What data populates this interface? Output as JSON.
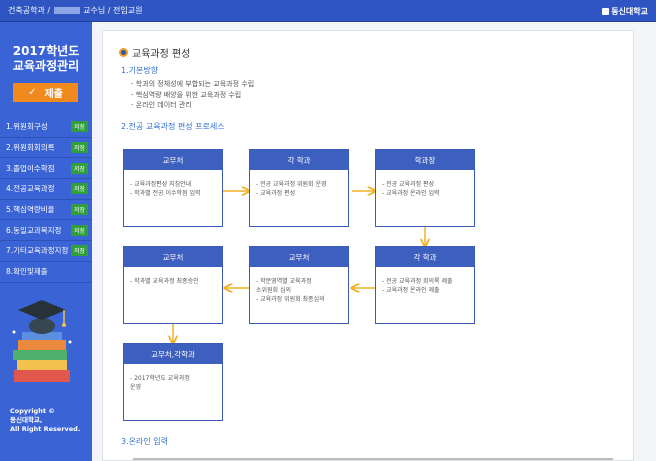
{
  "topbar": {
    "crumb_prefix": "건축공학과 /",
    "crumb_suffix": "교수님 / 전임교원",
    "logo": "동신대학교"
  },
  "sidebar": {
    "title_line1": "2017학년도",
    "title_line2": "교육과정관리",
    "submit_label": "제출",
    "items": [
      {
        "label": "1.위원회구성",
        "badge": "저장"
      },
      {
        "label": "2.위원회회의록",
        "badge": "저장"
      },
      {
        "label": "3.졸업이수학점",
        "badge": "저장"
      },
      {
        "label": "4.전공교육과정",
        "badge": "저장"
      },
      {
        "label": "5.핵심역량비율",
        "badge": "저장"
      },
      {
        "label": "6.동일교과목지정",
        "badge": "저장"
      },
      {
        "label": "7.기타교육과정지정",
        "badge": "저장"
      },
      {
        "label": "8.확인및제출",
        "badge": ""
      }
    ],
    "copyright_1": "Copyright ©",
    "copyright_2": "동신대학교,",
    "copyright_3": "All Right Reserved."
  },
  "main": {
    "page_title": "교육과정 편성",
    "sec1_title": "1.기본방향",
    "sec1_bullets": [
      "- 학과의 정체성에 부합되는 교육과정 수립",
      "- 핵심역량 배양을 위한 교육과정 수립",
      "- 온라인 데이터 관리"
    ],
    "sec2_title": "2.전공 교육과정 편성 프로세스",
    "boxes": {
      "b1": {
        "title": "교무처",
        "lines": [
          "- 교육과정편성 지침안내",
          "- 학과별 전공 이수학점 입력"
        ]
      },
      "b2": {
        "title": "각 학과",
        "lines": [
          "- 전공 교육과정 위원회 운영",
          "- 교육과정 편성"
        ]
      },
      "b3": {
        "title": "학과장",
        "lines": [
          "- 전공 교육과정 편성",
          "- 교육과정 온라인 입력"
        ]
      },
      "b4": {
        "title": "각 학과",
        "lines": [
          "- 전공 교육과정 회의록 제출",
          "- 교육과정 온라인 제출"
        ]
      },
      "b5": {
        "title": "교무처",
        "lines": [
          "- 학문영역별 교육과정",
          "  소위원회 심의",
          "- 교육과정 위원회 최종심의"
        ]
      },
      "b6": {
        "title": "교무처",
        "lines": [
          "- 학과별 교육과정 최종승인"
        ]
      },
      "b7": {
        "title": "교무처,각학과",
        "lines": [
          "- 2017학년도 교육과정",
          "  운영"
        ]
      }
    },
    "sec3_title": "3.온라인 입력"
  },
  "colors": {
    "topbar": "#2f55c2",
    "sidebar": "#3a63d6",
    "submit": "#f08a1c",
    "badge": "#2f9e3b",
    "box_header": "#3d5fbf",
    "arrow": "#f0b020",
    "section_title": "#2f6fd6"
  }
}
